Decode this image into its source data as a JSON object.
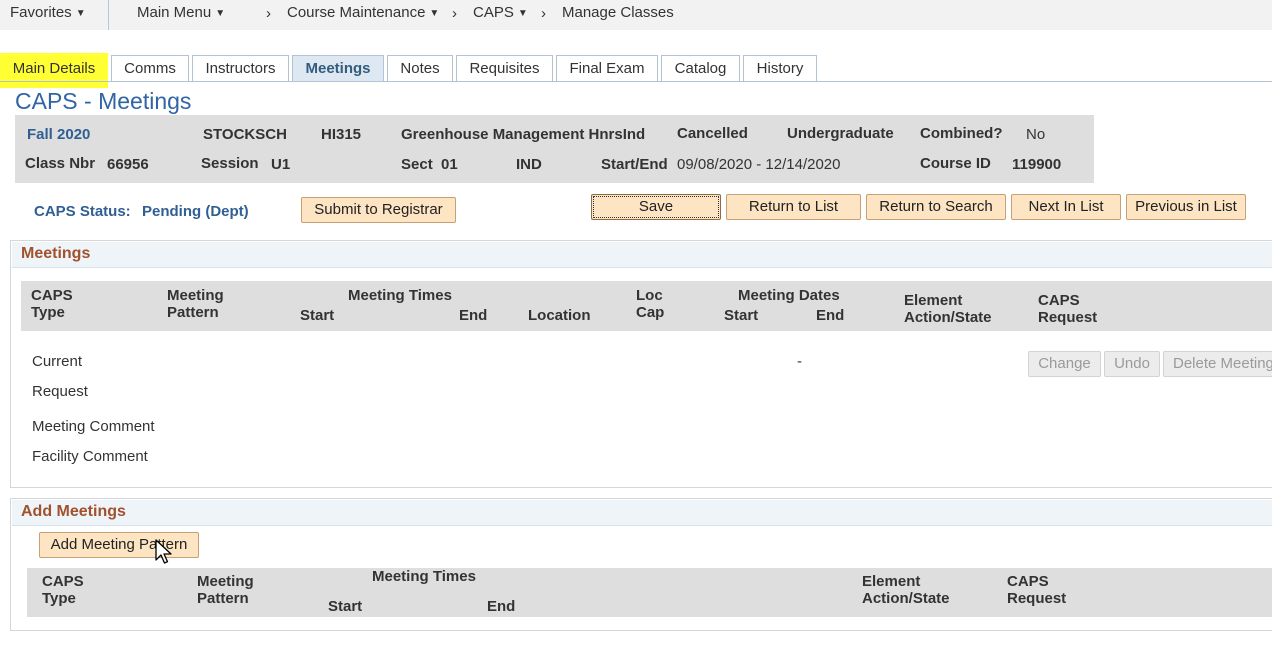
{
  "navbar": {
    "favorites": "Favorites",
    "main_menu": "Main Menu",
    "breadcrumbs": [
      "Course Maintenance",
      "CAPS",
      "Manage Classes"
    ]
  },
  "tabs": [
    {
      "label": "Main Details"
    },
    {
      "label": "Comms"
    },
    {
      "label": "Instructors"
    },
    {
      "label": "Meetings"
    },
    {
      "label": "Notes"
    },
    {
      "label": "Requisites"
    },
    {
      "label": "Final Exam"
    },
    {
      "label": "Catalog"
    },
    {
      "label": "History"
    }
  ],
  "page_title": "CAPS - Meetings",
  "header": {
    "term": "Fall 2020",
    "subject": "STOCKSCH",
    "catalog": "HI315",
    "course_title": "Greenhouse Management HnrsInd",
    "status": "Cancelled",
    "career": "Undergraduate",
    "combined_label": "Combined?",
    "combined_value": "No",
    "class_nbr_label": "Class Nbr",
    "class_nbr_value": "66956",
    "session_label": "Session",
    "session_value": "U1",
    "sect_label": "Sect",
    "sect_value": "01",
    "component": "IND",
    "start_end_label": "Start/End",
    "start_end_value": "09/08/2020 - 12/14/2020",
    "course_id_label": "Course ID",
    "course_id_value": "119900"
  },
  "caps_status": {
    "label": "CAPS Status:",
    "value": "Pending (Dept)"
  },
  "buttons": {
    "submit": "Submit to Registrar",
    "save": "Save",
    "return_list": "Return to List",
    "return_search": "Return to Search",
    "next": "Next In List",
    "previous": "Previous in List",
    "change": "Change",
    "undo": "Undo",
    "delete_meeting": "Delete Meeting",
    "add_meeting_pattern": "Add Meeting Pattern"
  },
  "meetings": {
    "title": "Meetings",
    "columns": {
      "caps": "CAPS",
      "type": "Type",
      "meeting": "Meeting",
      "pattern": "Pattern",
      "meeting_times": "Meeting Times",
      "start": "Start",
      "end": "End",
      "location": "Location",
      "loc": "Loc",
      "cap": "Cap",
      "meeting_dates": "Meeting Dates",
      "element": "Element",
      "action_state": "Action/State",
      "request": "Request"
    },
    "rows": [
      "Current",
      "Request",
      "Meeting Comment",
      "Facility Comment"
    ],
    "dates_dash": "-"
  },
  "add_meetings": {
    "title": "Add Meetings",
    "columns": {
      "caps": "CAPS",
      "type": "Type",
      "meeting": "Meeting",
      "pattern": "Pattern",
      "meeting_times": "Meeting Times",
      "start": "Start",
      "end": "End",
      "element": "Element",
      "action_state": "Action/State",
      "request": "Request"
    }
  },
  "colors": {
    "highlight": "#ffff33",
    "section_title": "#a0522d",
    "page_title": "#2f65a5",
    "button": "#fde4c2"
  },
  "icons": {
    "caret": "caret-down-icon",
    "breadcrumb_separator": "chevron-right-icon",
    "cursor": "mouse-pointer-icon"
  }
}
